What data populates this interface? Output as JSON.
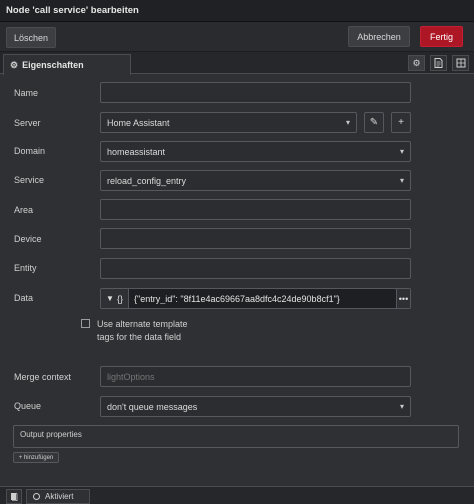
{
  "window": {
    "title": "Node 'call service' bearbeiten"
  },
  "toolbar": {
    "delete_label": "Löschen",
    "cancel_label": "Abbrechen",
    "done_label": "Fertig"
  },
  "tabs": {
    "properties_label": "Eigenschaften",
    "icons": [
      "gear-icon",
      "document-icon",
      "layout-icon"
    ]
  },
  "form": {
    "name": {
      "label": "Name",
      "value": ""
    },
    "server": {
      "label": "Server",
      "value": "Home Assistant"
    },
    "domain": {
      "label": "Domain",
      "value": "homeassistant"
    },
    "service": {
      "label": "Service",
      "value": "reload_config_entry"
    },
    "area": {
      "label": "Area",
      "value": ""
    },
    "device": {
      "label": "Device",
      "value": ""
    },
    "entity": {
      "label": "Entity",
      "value": ""
    },
    "data": {
      "label": "Data",
      "type_glyph": "{}",
      "value": "{\"entry_id\": \"8f11e4ac69667aa8dfc4c24de90b8cf1\"}"
    },
    "alternate_tags": {
      "label": "Use alternate template tags for the data field",
      "checked": false
    },
    "merge_context": {
      "label": "Merge context",
      "placeholder": "lightOptions"
    },
    "queue": {
      "label": "Queue",
      "value": "don't queue messages"
    },
    "output_properties": {
      "label": "Output properties",
      "add_label": "+ hinzufügen"
    }
  },
  "footer": {
    "enabled_label": "Aktiviert"
  },
  "colors": {
    "accent": "#ad1625",
    "background": "#2e3033"
  }
}
